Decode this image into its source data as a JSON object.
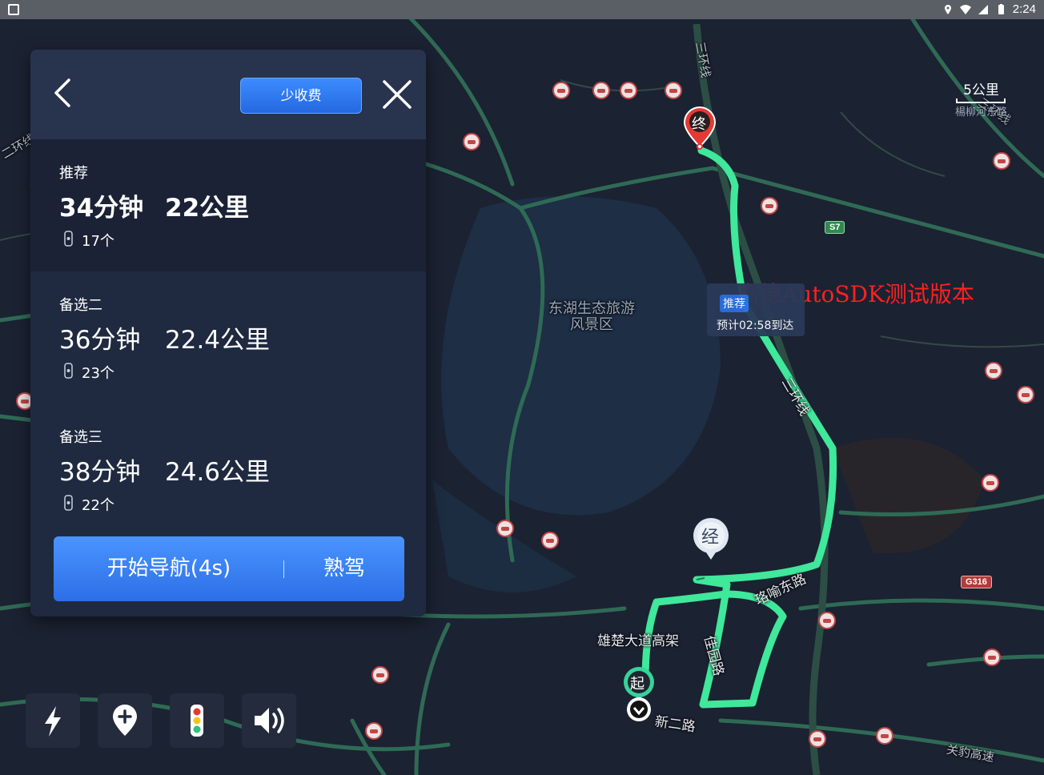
{
  "status_bar": {
    "time": "2:24"
  },
  "map": {
    "scale": {
      "value": "5公里",
      "sub": "楊柳河东路"
    },
    "watermark": "高德AutoSDK测试版本",
    "area_label": "东湖生态旅游风景区",
    "eta_card": {
      "tag": "推荐",
      "eta": "预计02:58到达"
    },
    "road_labels": {
      "third_ring_north": "三环线",
      "third_ring_east": "三环线",
      "second_ring": "二环线",
      "third_ring_ne": "三环线",
      "luoyu_east": "珞喻东路",
      "xiongchu": "雄楚大道高架",
      "jiayuan": "佳园路",
      "xiner": "新二路",
      "guanbao": "关豹高速"
    },
    "road_badges": {
      "s7": "S7",
      "g316": "G316"
    },
    "pins": {
      "end": "终",
      "start": "起",
      "via": "经"
    }
  },
  "panel": {
    "toll_button": "少收费",
    "routes": [
      {
        "label": "推荐",
        "time": "34分钟",
        "distance": "22公里",
        "lights": "17个"
      },
      {
        "label": "备选二",
        "time": "36分钟",
        "distance": "22.4公里",
        "lights": "23个"
      },
      {
        "label": "备选三",
        "time": "38分钟",
        "distance": "24.6公里",
        "lights": "22个"
      }
    ],
    "start_nav": "开始导航(4s)",
    "familiar": "熟驾"
  },
  "toolbar": {
    "items": [
      "flash-icon",
      "add-waypoint-icon",
      "traffic-light-icon",
      "volume-icon"
    ]
  },
  "colors": {
    "route": "#3fe89a",
    "primary": "#3a82f6",
    "end_pin": "#e53935",
    "start_pin": "#35d49a"
  }
}
